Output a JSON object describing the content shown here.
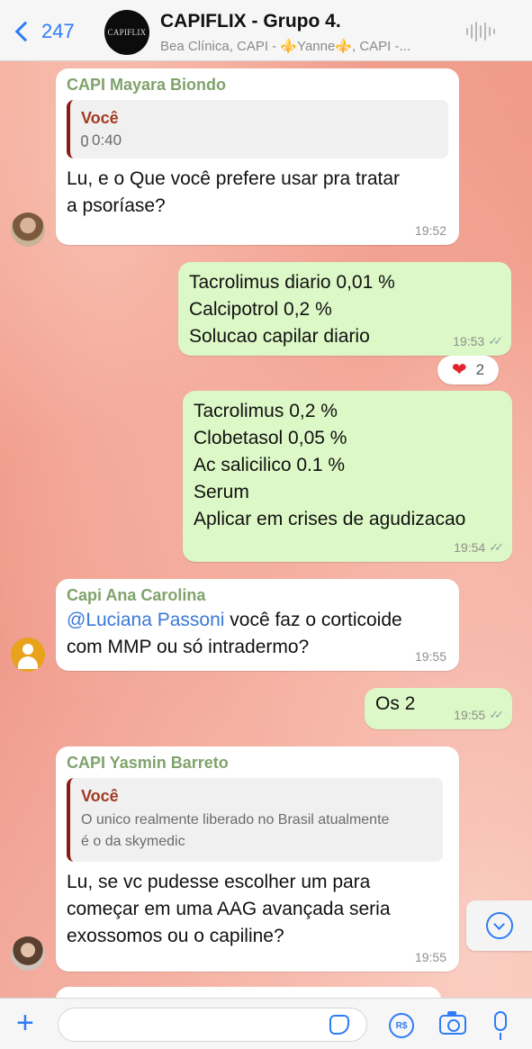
{
  "header": {
    "back_count": "247",
    "avatar_text": "CAPIFLIX",
    "title": "CAPIFLIX - Grupo 4.",
    "subtitle": "Bea Clínica, CAPI - ⚜️Yanne⚜️, CAPI -..."
  },
  "messages": [
    {
      "sender": "CAPI Mayara Biondo",
      "quote_author": "Você",
      "quote_audio": "0:40",
      "text": "Lu, e o Que você prefere usar pra tratar\na psoríase?",
      "time": "19:52"
    },
    {
      "text": "Tacrolimus diario 0,01 %\nCalcipotrol 0,2 %\nSolucao capilar diario",
      "time": "19:53",
      "reaction": {
        "emoji": "❤️",
        "count": "2"
      }
    },
    {
      "text": "Tacrolimus 0,2 %\nClobetasol 0,05 %\nAc salicilico 0.1 %\nSerum\nAplicar em crises de agudizacao",
      "time": "19:54"
    },
    {
      "sender": "Capi Ana Carolina",
      "mention": "@Luciana Passoni",
      "text_after": " você faz o corticoide",
      "text2": "com MMP ou só intradermo?",
      "time": "19:55"
    },
    {
      "text": "Os 2",
      "time": "19:55"
    },
    {
      "sender": "CAPI Yasmin Barreto",
      "quote_author": "Você",
      "quote_text": "O unico realmente liberado no Brasil atualmente\né o da skymedic",
      "text": "Lu, se vc pudesse escolher um para\ncomeçar em uma AAG avançada seria\nexossomos ou o capiline?",
      "time": "19:55"
    }
  ],
  "input": {
    "placeholder": "",
    "pay_label": "R$"
  },
  "colors": {
    "accent": "#2f7cf6",
    "outgoing_bubble": "#dcf8c6",
    "incoming_bubble": "#ffffff",
    "sender_name": "#7fa36b",
    "quote_author": "#a23a23",
    "mention": "#3a79d6"
  },
  "icons": [
    "back-chevron-icon",
    "audio-wave-icon",
    "mic-icon",
    "heart-icon",
    "chevron-down-icon",
    "plus-icon",
    "sticker-icon",
    "pay-icon",
    "camera-icon",
    "microphone-icon"
  ]
}
